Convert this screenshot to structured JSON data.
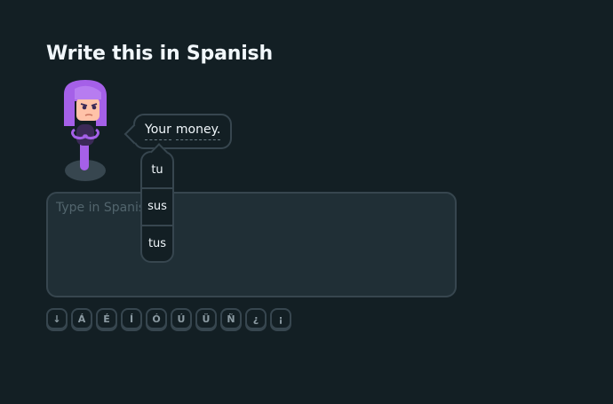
{
  "header": {
    "title": "Write this in Spanish"
  },
  "character": {
    "name_icon": "lily-character-icon",
    "hair_color": "#a560e8",
    "skin_color": "#ffc2a8"
  },
  "prompt": {
    "words": [
      "Your",
      "money."
    ]
  },
  "hint": {
    "options": [
      "tu",
      "sus",
      "tus"
    ]
  },
  "answer": {
    "placeholder": "Type in Spanish",
    "value": ""
  },
  "keyboard": {
    "keys": [
      "↓",
      "Á",
      "É",
      "Í",
      "Ó",
      "Ú",
      "Ü",
      "Ñ",
      "¿",
      "¡"
    ]
  },
  "colors": {
    "background": "#131f24",
    "border": "#37464f",
    "input_bg": "#202f36",
    "text": "#f1f7fb"
  }
}
